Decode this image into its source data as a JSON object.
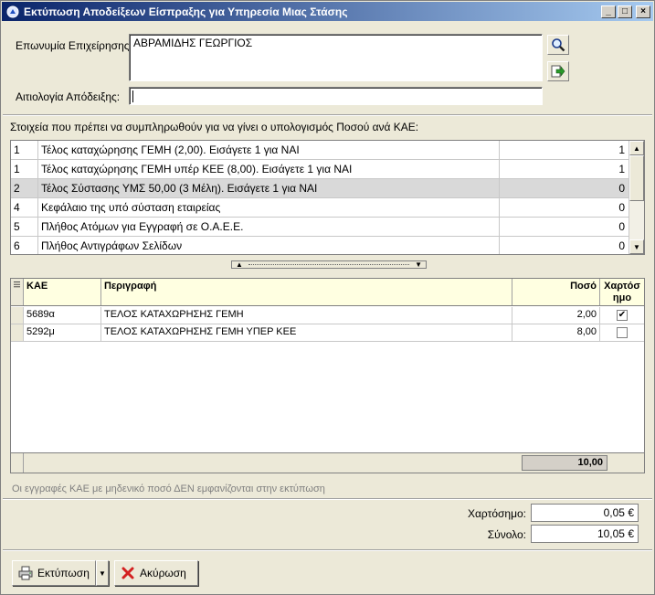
{
  "window": {
    "title": "Εκτύπωση Αποδείξεων Είσπραξης για Υπηρεσία Μιας Στάσης",
    "minimize": "_",
    "maximize": "□",
    "close": "×"
  },
  "form": {
    "company_label": "Επωνυμία Επιχείρησης:",
    "company_value": "ΑΒΡΑΜΙΔΗΣ ΓΕΩΡΓΙΟΣ",
    "reason_label": "Αιτιολογία Απόδειξης:",
    "reason_value": ""
  },
  "fields_section": {
    "heading": "Στοιχεία που πρέπει να συμπληρωθούν για να γίνει ο υπολογισμός Ποσού ανά ΚΑΕ:",
    "rows": [
      {
        "no": "1",
        "desc": "Τέλος καταχώρησης ΓΕΜΗ (2,00). Εισάγετε 1 για ΝΑΙ",
        "value": "1"
      },
      {
        "no": "1",
        "desc": "Τέλος καταχώρησης ΓΕΜΗ υπέρ ΚΕΕ (8,00). Εισάγετε 1 για ΝΑΙ",
        "value": "1"
      },
      {
        "no": "2",
        "desc": "Τέλος Σύστασης ΥΜΣ  50,00 (3 Μέλη). Εισάγετε 1 για ΝΑΙ",
        "value": "0"
      },
      {
        "no": "4",
        "desc": "Κεφάλαιο της υπό σύσταση εταιρείας",
        "value": "0"
      },
      {
        "no": "5",
        "desc": "Πλήθος Ατόμων για Εγγραφή σε Ο.Α.Ε.Ε.",
        "value": "0"
      },
      {
        "no": "6",
        "desc": "Πλήθος Αντιγράφων Σελίδων",
        "value": "0"
      }
    ]
  },
  "kae_table": {
    "headers": {
      "kae": "ΚΑΕ",
      "desc": "Περιγραφή",
      "poso": "Ποσό",
      "xart": "Χαρτόσ ημο"
    },
    "rows": [
      {
        "kae": "5689α",
        "desc": "ΤΕΛΟΣ ΚΑΤΑΧΩΡΗΣΗΣ ΓΕΜΗ",
        "poso": "2,00",
        "checked": true
      },
      {
        "kae": "5292μ",
        "desc": "ΤΕΛΟΣ ΚΑΤΑΧΩΡΗΣΗΣ ΓΕΜΗ ΥΠΕΡ ΚΕΕ",
        "poso": "8,00",
        "checked": false
      }
    ],
    "total": "10,00"
  },
  "note": "Οι εγγραφές ΚΑΕ με μηδενικό ποσό ΔΕΝ εμφανίζονται στην εκτύπωση",
  "summary": {
    "stamp_label": "Χαρτόσημο:",
    "stamp_value": "0,05 €",
    "total_label": "Σύνολο:",
    "total_value": "10,05 €"
  },
  "buttons": {
    "print": "Εκτύπωση",
    "cancel": "Ακύρωση"
  },
  "colors": {
    "title_start": "#0a246a",
    "title_end": "#a6caf0",
    "header_bg": "#ffffe1",
    "cancel_icon": "#d32020"
  }
}
